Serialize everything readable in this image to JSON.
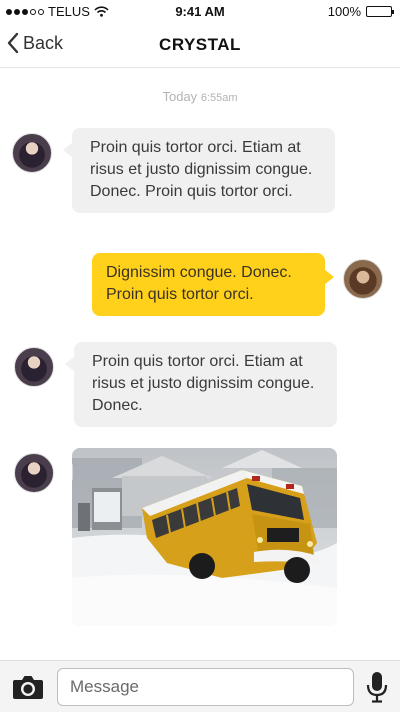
{
  "status_bar": {
    "carrier": "TELUS",
    "time": "9:41 AM",
    "battery": "100%",
    "signal_icon": "signal-dots-icon",
    "wifi_icon": "wifi-icon",
    "battery_icon": "battery-icon"
  },
  "nav": {
    "back_label": "Back",
    "title": "CRYSTAL",
    "back_icon": "chevron-left-icon"
  },
  "timestamp": {
    "day": "Today",
    "time": "6:55am"
  },
  "messages": [
    {
      "sender": "crystal",
      "direction": "incoming",
      "text": "Proin quis tortor orci. Etiam at risus et justo dignissim congue. Donec. Proin quis tortor orci."
    },
    {
      "sender": "me",
      "direction": "outgoing",
      "text": "Dignissim congue. Donec. Proin quis tortor orci."
    },
    {
      "sender": "crystal",
      "direction": "incoming",
      "text": "Proin quis tortor orci. Etiam at risus et justo dignissim congue. Donec."
    },
    {
      "sender": "crystal",
      "direction": "incoming",
      "type": "image",
      "image_subject": "yellow school bus in snow"
    }
  ],
  "composer": {
    "placeholder": "Message",
    "camera_icon": "camera-icon",
    "mic_icon": "microphone-icon"
  },
  "colors": {
    "incoming_bubble": "#f0f0f0",
    "outgoing_bubble": "#ffd11a",
    "timestamp_text": "#b3b3b3"
  }
}
